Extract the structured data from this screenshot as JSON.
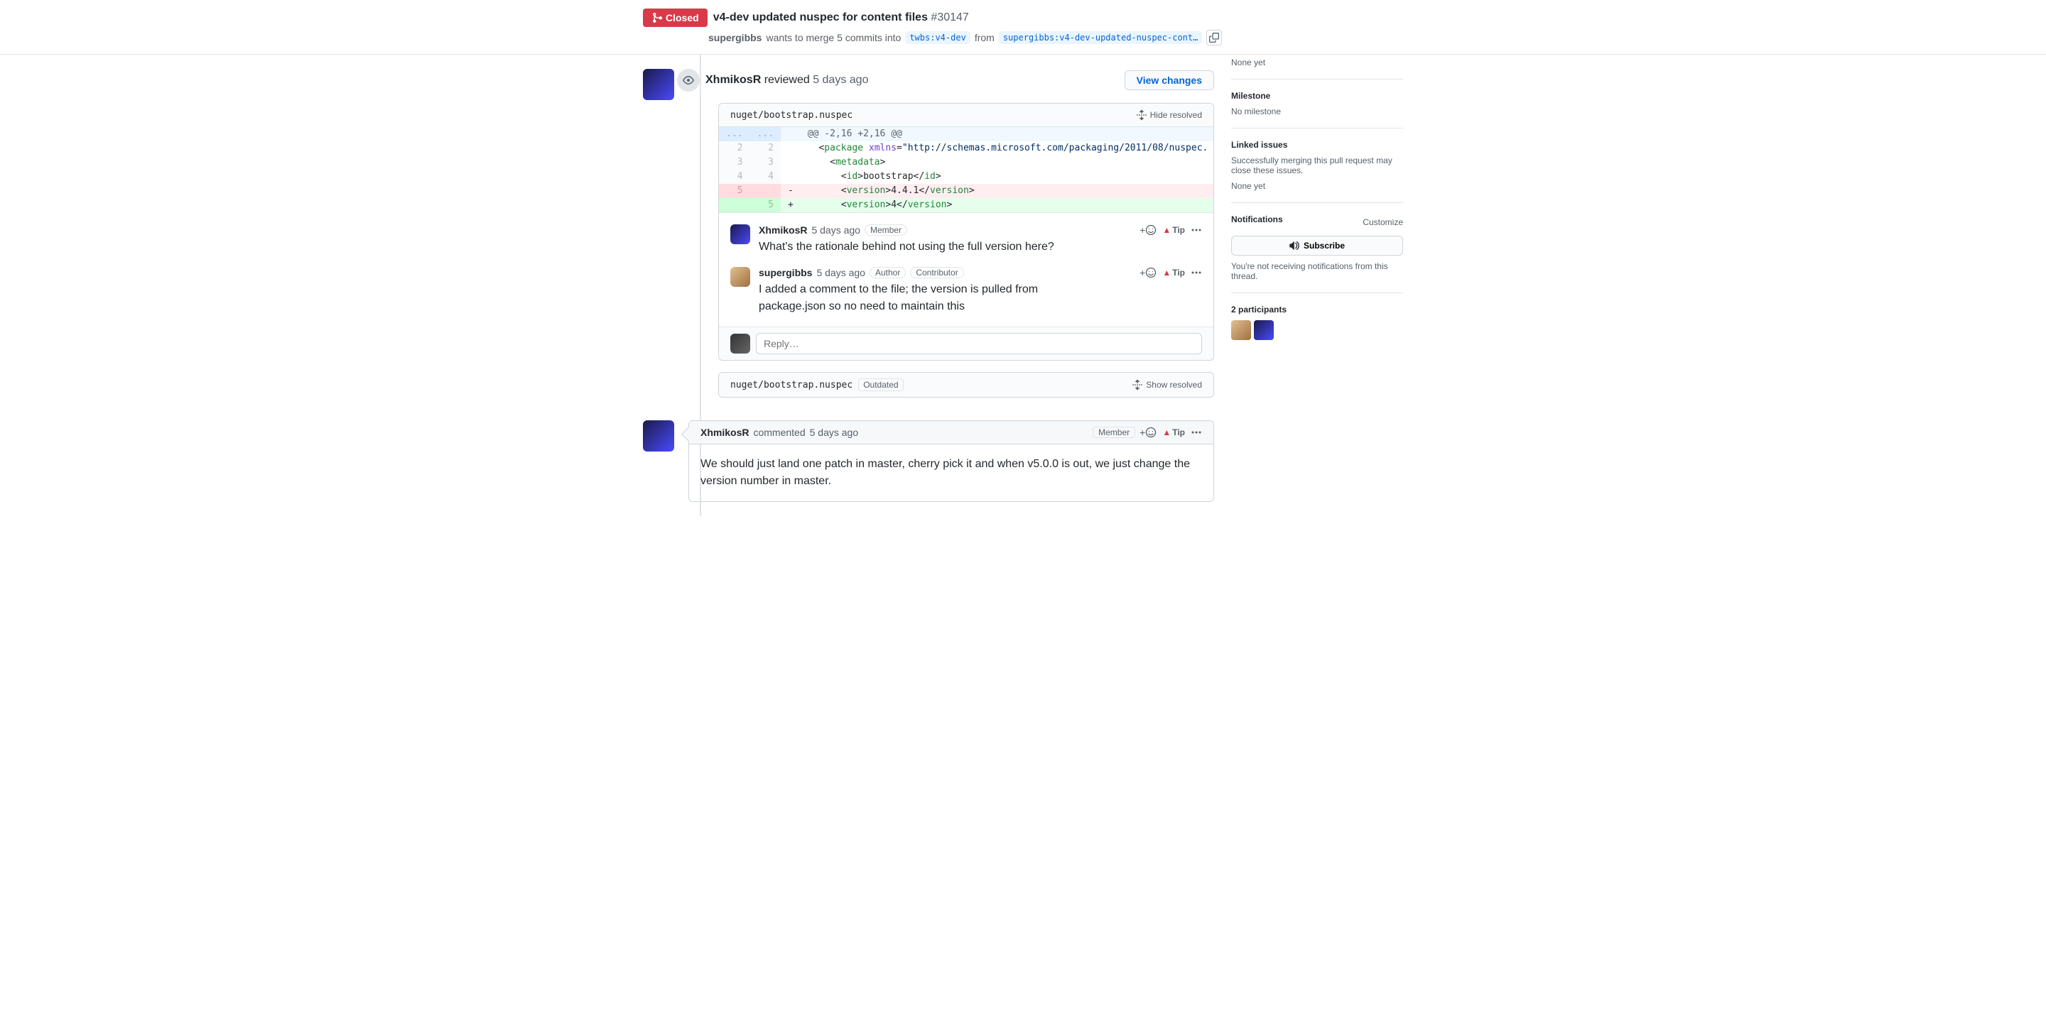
{
  "header": {
    "state": "Closed",
    "title": "v4-dev updated nuspec for content files",
    "number": "#30147",
    "author": "supergibbs",
    "merge_text_1": "wants to merge 5 commits into",
    "base_branch": "twbs:v4-dev",
    "from_text": "from",
    "head_branch": "supergibbs:v4-dev-updated-nuspec-cont…"
  },
  "review": {
    "reviewer": "XhmikosR",
    "action": "reviewed",
    "time": "5 days ago",
    "view_changes": "View changes",
    "file_path": "nuget/bootstrap.nuspec",
    "hide_resolved": "Hide resolved",
    "hunk": "@@ -2,16 +2,16 @@",
    "reply_placeholder": "Reply…"
  },
  "diff": {
    "l2_num": "2",
    "l3_num": "3",
    "l4_num": "4",
    "l5_num": "5",
    "dots": "..."
  },
  "inline_comments": [
    {
      "author": "XhmikosR",
      "time": "5 days ago",
      "roles": [
        "Member"
      ],
      "body": "What's the rationale behind not using the full version here?",
      "tip": "Tip"
    },
    {
      "author": "supergibbs",
      "time": "5 days ago",
      "roles": [
        "Author",
        "Contributor"
      ],
      "body": "I added a comment to the file; the version is pulled from package.json so no need to maintain this",
      "tip": "Tip"
    }
  ],
  "resolved_file": {
    "path": "nuget/bootstrap.nuspec",
    "outdated": "Outdated",
    "show_resolved": "Show resolved"
  },
  "bottom_comment": {
    "author": "XhmikosR",
    "action": "commented",
    "time": "5 days ago",
    "role": "Member",
    "tip": "Tip",
    "body": "We should just land one patch in master, cherry pick it and when v5.0.0 is out, we just change the version number in master."
  },
  "sidebar": {
    "none_yet_top": "None yet",
    "milestone_h": "Milestone",
    "milestone_v": "No milestone",
    "linked_h": "Linked issues",
    "linked_desc": "Successfully merging this pull request may close these issues.",
    "linked_v": "None yet",
    "notif_h": "Notifications",
    "customize": "Customize",
    "subscribe": "Subscribe",
    "notif_desc": "You're not receiving notifications from this thread.",
    "participants_h": "2 participants"
  },
  "reaction_plus": "+"
}
